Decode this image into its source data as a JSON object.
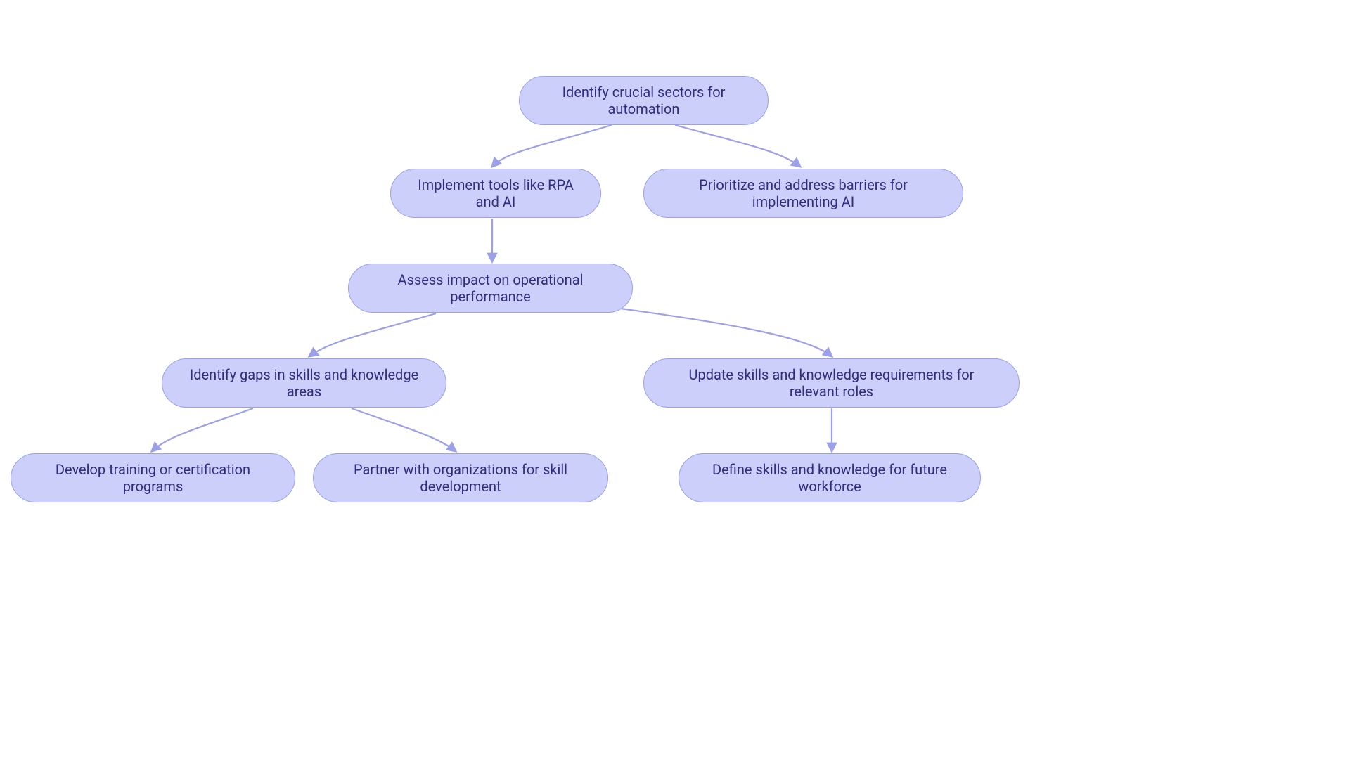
{
  "diagram": {
    "type": "flowchart",
    "nodes": {
      "n0": {
        "label": "Identify crucial sectors for automation"
      },
      "n1": {
        "label": "Implement tools like RPA and AI"
      },
      "n2": {
        "label": "Prioritize and address barriers for implementing AI"
      },
      "n3": {
        "label": "Assess impact on operational performance"
      },
      "n4": {
        "label": "Identify gaps in skills and knowledge areas"
      },
      "n5": {
        "label": "Update skills and knowledge requirements for relevant roles"
      },
      "n6": {
        "label": "Develop training or certification programs"
      },
      "n7": {
        "label": "Partner with organizations for skill development"
      },
      "n8": {
        "label": "Define skills and knowledge for future workforce"
      }
    },
    "edges": [
      {
        "from": "n0",
        "to": "n1"
      },
      {
        "from": "n0",
        "to": "n2"
      },
      {
        "from": "n1",
        "to": "n3"
      },
      {
        "from": "n3",
        "to": "n4"
      },
      {
        "from": "n3",
        "to": "n5"
      },
      {
        "from": "n4",
        "to": "n6"
      },
      {
        "from": "n4",
        "to": "n7"
      },
      {
        "from": "n5",
        "to": "n8"
      }
    ],
    "colors": {
      "node_fill": "#cccffa",
      "node_stroke": "#9ba0e8",
      "node_text": "#2e2e80",
      "edge": "#9ba0e8"
    }
  }
}
